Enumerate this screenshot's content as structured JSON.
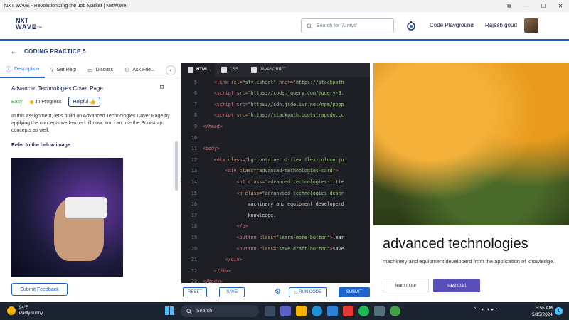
{
  "window": {
    "title": "NXT WAVE - Revolutionizing the Job Market | NxtWave"
  },
  "header": {
    "logo_line1": "NXT",
    "logo_line2": "WAVE",
    "logo_tm": "TM",
    "search_placeholder": "Search for 'Arrays'",
    "code_playground": "Code Playground",
    "user_name": "Rajesh goud"
  },
  "breadcrumb": {
    "title": "CODING PRACTICE 5"
  },
  "left_panel": {
    "tabs": [
      {
        "label": "Description"
      },
      {
        "label": "Get Help"
      },
      {
        "label": "Discuss"
      },
      {
        "label": "Ask Frie..."
      }
    ],
    "problem_title": "Advanced Technologies Cover Page",
    "difficulty": "Easy",
    "status": "In Progress",
    "helpful_label": "Helpful",
    "description": "In this assignment, let's build an Advanced Technologies Cover Page by applying the concepts we learned till now. You can use the Bootstrap concepts as well.",
    "refer_text": "Refer to the below image.",
    "submit_feedback": "Submit Feedback"
  },
  "editor": {
    "tabs": [
      {
        "label": "HTML"
      },
      {
        "label": "CSS"
      },
      {
        "label": "JAVASCRIPT"
      }
    ],
    "lines": [
      {
        "n": "5",
        "indent": "    ",
        "parts": [
          [
            "tag",
            "<link "
          ],
          [
            "attr",
            "rel="
          ],
          [
            "str",
            "\"stylesheet\" "
          ],
          [
            "attr",
            "href="
          ],
          [
            "str",
            "\"https://stackpath"
          ]
        ]
      },
      {
        "n": "6",
        "indent": "    ",
        "parts": [
          [
            "tag",
            "<script "
          ],
          [
            "attr",
            "src="
          ],
          [
            "str",
            "\"https://code.jquery.com/jquery-3."
          ]
        ]
      },
      {
        "n": "7",
        "indent": "    ",
        "parts": [
          [
            "tag",
            "<script "
          ],
          [
            "attr",
            "src="
          ],
          [
            "str",
            "\"https://cdn.jsdelivr.net/npm/popp"
          ]
        ]
      },
      {
        "n": "8",
        "indent": "    ",
        "parts": [
          [
            "tag",
            "<script "
          ],
          [
            "attr",
            "src="
          ],
          [
            "str",
            "\"https://stackpath.bootstrapcdn.cc"
          ]
        ]
      },
      {
        "n": "9",
        "indent": "",
        "parts": [
          [
            "tag",
            "</head>"
          ]
        ]
      },
      {
        "n": "10",
        "indent": "",
        "parts": []
      },
      {
        "n": "11",
        "indent": "",
        "parts": [
          [
            "tag",
            "<body>"
          ]
        ]
      },
      {
        "n": "12",
        "indent": "    ",
        "parts": [
          [
            "tag",
            "<div "
          ],
          [
            "attr",
            "class="
          ],
          [
            "str",
            "\"bg-container d-flex flex-column ju"
          ]
        ]
      },
      {
        "n": "13",
        "indent": "        ",
        "parts": [
          [
            "tag",
            "<div "
          ],
          [
            "attr",
            "class="
          ],
          [
            "str",
            "\"advanced-technologies-card\""
          ],
          [
            "tag",
            ">"
          ]
        ]
      },
      {
        "n": "14",
        "indent": "            ",
        "parts": [
          [
            "tag",
            "<h1 "
          ],
          [
            "attr",
            "class="
          ],
          [
            "str",
            "\"advanced technologies-title"
          ]
        ]
      },
      {
        "n": "15",
        "indent": "            ",
        "parts": [
          [
            "tag",
            "<p "
          ],
          [
            "attr",
            "class="
          ],
          [
            "str",
            "\"advanvced-technologies-descr"
          ]
        ]
      },
      {
        "n": "16",
        "indent": "                ",
        "parts": [
          [
            "txt",
            "machinery and equipment developerd"
          ]
        ]
      },
      {
        "n": "17",
        "indent": "                ",
        "parts": [
          [
            "txt",
            "knowledge."
          ]
        ]
      },
      {
        "n": "18",
        "indent": "            ",
        "parts": [
          [
            "tag",
            "</p>"
          ]
        ]
      },
      {
        "n": "19",
        "indent": "            ",
        "parts": [
          [
            "tag",
            "<button "
          ],
          [
            "attr",
            "class="
          ],
          [
            "str",
            "\"learn-more-button\""
          ],
          [
            "tag",
            ">"
          ],
          [
            "txt",
            "lear"
          ]
        ]
      },
      {
        "n": "20",
        "indent": "            ",
        "parts": [
          [
            "tag",
            "<button "
          ],
          [
            "attr",
            "class="
          ],
          [
            "str",
            "\"save-draft-button\""
          ],
          [
            "tag",
            ">"
          ],
          [
            "txt",
            "save"
          ]
        ]
      },
      {
        "n": "21",
        "indent": "        ",
        "parts": [
          [
            "tag",
            "</div>"
          ]
        ]
      },
      {
        "n": "22",
        "indent": "    ",
        "parts": [
          [
            "tag",
            "</div>"
          ]
        ]
      },
      {
        "n": "23",
        "indent": "",
        "parts": [
          [
            "tag",
            "</body>"
          ]
        ]
      },
      {
        "n": "24",
        "indent": "",
        "parts": []
      }
    ],
    "reset_label": "RESET",
    "save_label": "SAVE",
    "run_code_label": "RUN CODE",
    "submit_label": "SUBMIT"
  },
  "preview": {
    "title": "advanced technologies",
    "description": "machinery and equipment developerd from the application of knowledge.",
    "learn_more": "learn more",
    "save_draft": "save draft"
  },
  "taskbar": {
    "temperature": "94°F",
    "weather": "Partly sunny",
    "search_label": "Search",
    "time": "5:55 AM",
    "date": "5/15/2024",
    "notification_count": "1",
    "tray_arrow": "^"
  }
}
